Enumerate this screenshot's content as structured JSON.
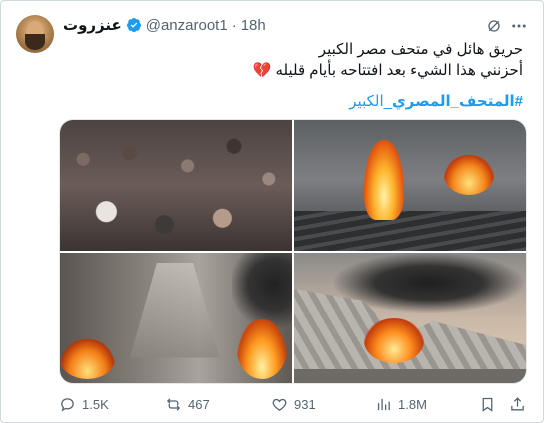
{
  "user": {
    "display_name": "عنزروت",
    "handle": "@anzaroot1",
    "separator": "·",
    "time": "18h",
    "verified_icon": "verified-badge-icon"
  },
  "tweet": {
    "line1": "حريق هائل في متحف مصر الكبير",
    "line2": "أحزنني هذا الشيء بعد افتتاحه بأيام قليله",
    "heart": "💔",
    "hashtag_bold": "#المتحف_المصري",
    "hashtag_rest": "_الكبير"
  },
  "media": {
    "images": [
      "crowd-image",
      "museum-fire-interior-image",
      "stairway-fire-image",
      "museum-exterior-fire-image"
    ]
  },
  "actions": {
    "replies": "1.5K",
    "reposts": "467",
    "likes": "931",
    "views": "1.8M"
  },
  "colors": {
    "link": "#1d9bf0",
    "muted": "#536471",
    "text": "#0f1419"
  }
}
